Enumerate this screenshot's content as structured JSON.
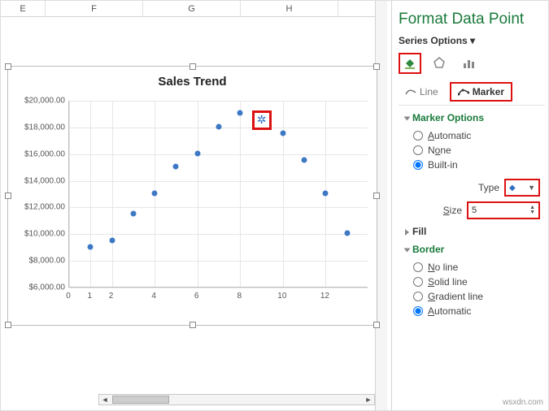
{
  "columns": [
    "E",
    "F",
    "G",
    "H"
  ],
  "pane": {
    "title": "Format Data Point",
    "series_label": "Series Options",
    "tabs": {
      "line": "Line",
      "marker": "Marker"
    },
    "marker_options": {
      "header": "Marker Options",
      "automatic": "Automatic",
      "none": "None",
      "builtin": "Built-in",
      "type_label": "Type",
      "type_value": "◆",
      "size_label": "Size",
      "size_value": "5"
    },
    "fill": "Fill",
    "border": {
      "header": "Border",
      "no_line": "No line",
      "solid": "Solid line",
      "gradient": "Gradient line",
      "automatic": "Automatic"
    }
  },
  "watermark": "wsxdn.com",
  "chart_data": {
    "type": "scatter",
    "title": "Sales Trend",
    "xlabel": "",
    "ylabel": "",
    "xlim": [
      0,
      14
    ],
    "ylim": [
      6000,
      20000
    ],
    "y_ticks": [
      "$20,000.00",
      "$18,000.00",
      "$16,000.00",
      "$14,000.00",
      "$12,000.00",
      "$10,000.00",
      "$8,000.00",
      "$6,000.00"
    ],
    "x_ticks": [
      0,
      2,
      4,
      6,
      8,
      10,
      12,
      1
    ],
    "x": [
      1,
      2,
      3,
      4,
      5,
      6,
      7,
      8,
      9,
      10,
      11,
      12,
      13
    ],
    "y": [
      9000,
      9500,
      11500,
      13000,
      15000,
      16000,
      18000,
      19000,
      18500,
      17500,
      15500,
      13000,
      10000
    ],
    "selected_index": 8
  }
}
